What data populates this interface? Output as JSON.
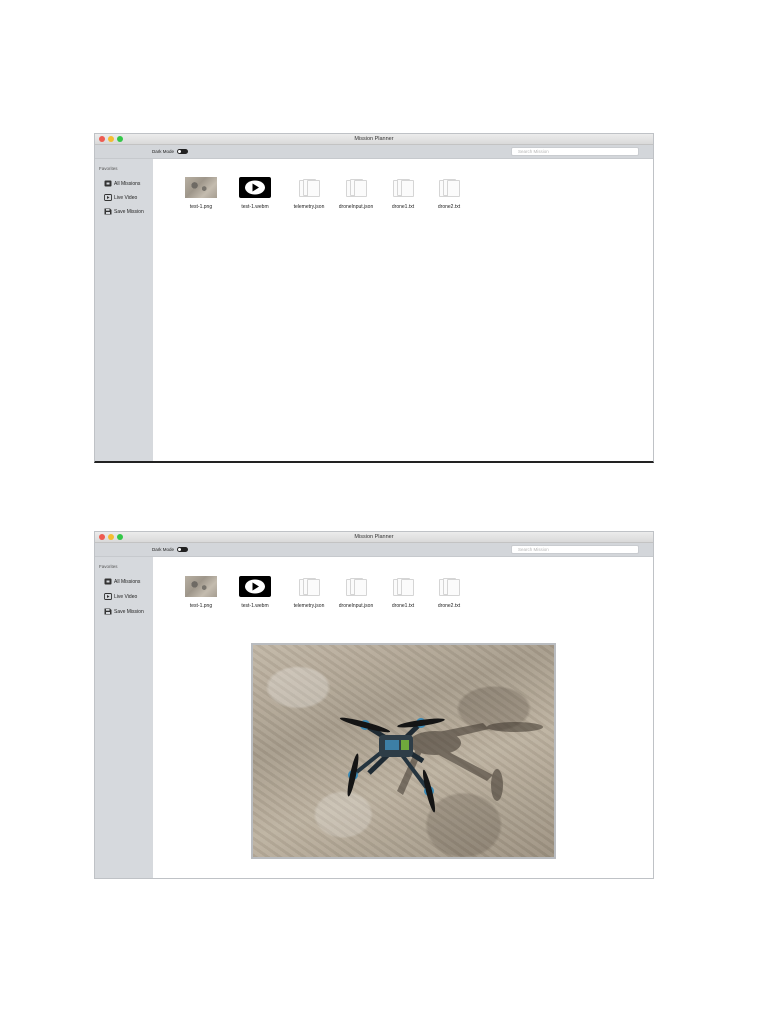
{
  "windows": [
    {
      "title": "Mission Planner",
      "toolbar": {
        "dark_mode_label": "Dark Mode",
        "search_placeholder": "Search Mission"
      },
      "sidebar": {
        "section_title": "Favorites",
        "items": [
          {
            "label": "All Missions",
            "icon": "folder-icon"
          },
          {
            "label": "Live Video",
            "icon": "play-icon"
          },
          {
            "label": "Save Mission",
            "icon": "save-icon"
          }
        ]
      },
      "files": [
        {
          "name": "test-1.png",
          "icon": "image-thumbnail"
        },
        {
          "name": "test-1.webm",
          "icon": "video-play-icon"
        },
        {
          "name": "telemetry.json",
          "icon": "document-icon"
        },
        {
          "name": "droneInput.json",
          "icon": "document-icon"
        },
        {
          "name": "drone1.txt",
          "icon": "document-icon"
        },
        {
          "name": "drone2.txt",
          "icon": "document-icon"
        }
      ]
    },
    {
      "title": "Mission Planner",
      "toolbar": {
        "dark_mode_label": "Dark Mode",
        "search_placeholder": "Search Mission"
      },
      "sidebar": {
        "section_title": "Favorites",
        "items": [
          {
            "label": "All Missions",
            "icon": "folder-icon"
          },
          {
            "label": "Live Video",
            "icon": "play-icon"
          },
          {
            "label": "Save Mission",
            "icon": "save-icon"
          }
        ]
      },
      "files": [
        {
          "name": "test-1.png",
          "icon": "image-thumbnail"
        },
        {
          "name": "test-1.webm",
          "icon": "video-play-icon"
        },
        {
          "name": "telemetry.json",
          "icon": "document-icon"
        },
        {
          "name": "droneInput.json",
          "icon": "document-icon"
        },
        {
          "name": "drone1.txt",
          "icon": "document-icon"
        },
        {
          "name": "drone2.txt",
          "icon": "document-icon"
        }
      ],
      "preview": {
        "content": "drone-on-sand-photo"
      }
    }
  ],
  "colors": {
    "sidebar_bg": "#d6d9dd",
    "toolbar_bg": "#d3d6da",
    "close": "#ee5b51",
    "minimize": "#f4bd32",
    "zoom": "#33c748"
  }
}
